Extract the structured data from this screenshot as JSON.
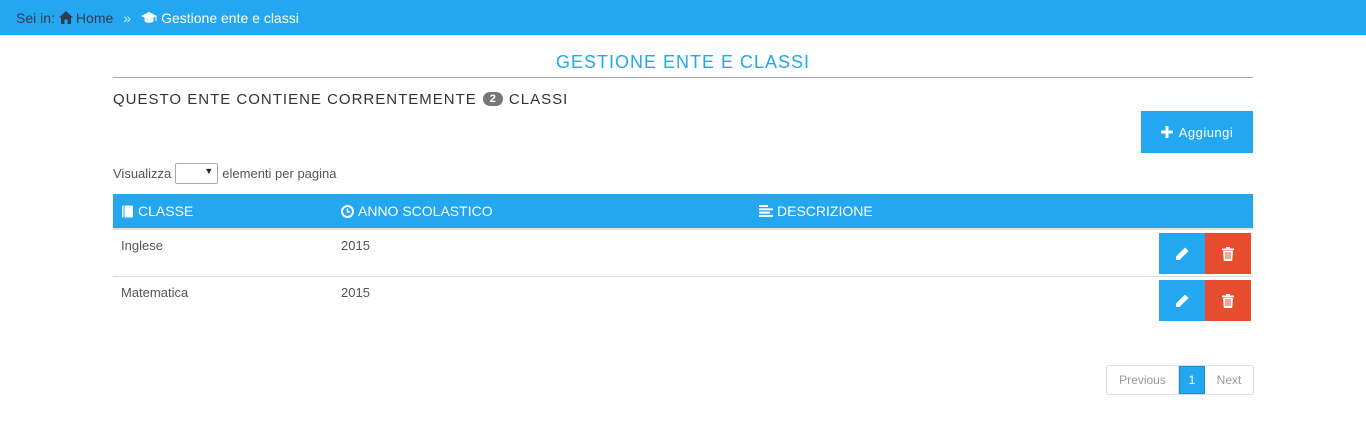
{
  "breadcrumb": {
    "prefix": "Sei in:",
    "home_label": "Home",
    "separator": "»",
    "current_label": "Gestione ente e classi"
  },
  "page": {
    "title": "GESTIONE ENTE E CLASSI",
    "count_prefix": "QUESTO ENTE CONTIENE CORRENTEMENTE",
    "count_value": "2",
    "count_suffix": "CLASSI"
  },
  "toolbar": {
    "add_label": "Aggiungi"
  },
  "page_size": {
    "prefix": "Visualizza",
    "suffix": "elementi per pagina",
    "selected": ""
  },
  "table": {
    "headers": [
      "CLASSE",
      "ANNO SCOLASTICO",
      "DESCRIZIONE"
    ],
    "rows": [
      {
        "classe": "Inglese",
        "anno": "2015",
        "descrizione": ""
      },
      {
        "classe": "Matematica",
        "anno": "2015",
        "descrizione": ""
      }
    ]
  },
  "pagination": {
    "previous": "Previous",
    "current": "1",
    "next": "Next"
  },
  "colors": {
    "accent": "#22a7f0",
    "danger": "#e74c2e",
    "badge": "#777777"
  },
  "icons": {
    "home": "home-icon",
    "graduation": "graduation-cap-icon",
    "plus": "plus-icon",
    "book": "book-icon",
    "clock": "clock-icon",
    "description": "align-left-icon",
    "edit": "pencil-icon",
    "delete": "trash-icon"
  }
}
